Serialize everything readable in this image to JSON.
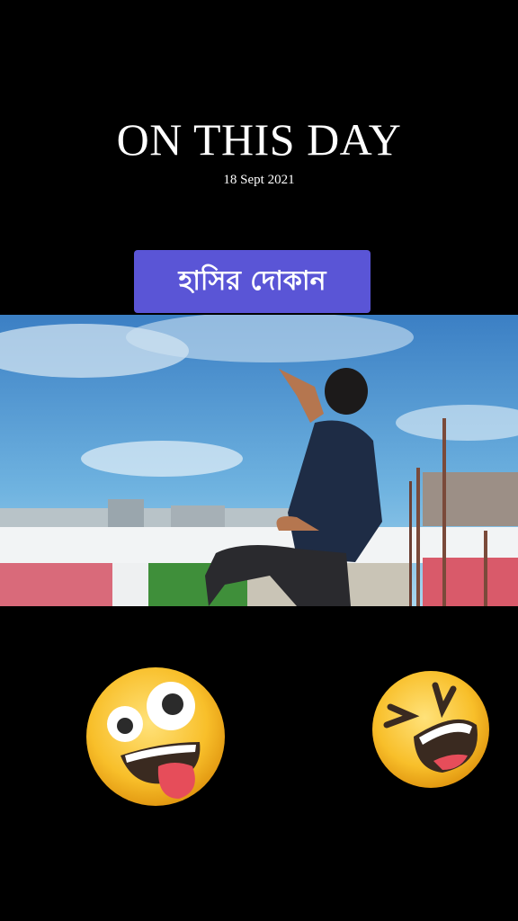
{
  "header": {
    "title": "ON THIS DAY",
    "date": "18 Sept 2021"
  },
  "label": {
    "text": "হাসির দোকান",
    "color": "#5a55d6"
  },
  "media": {
    "description_icon": "photo-dancing-man-rooftop"
  },
  "emojis": [
    {
      "name": "zany-face-icon"
    },
    {
      "name": "laughing-squint-face-icon"
    }
  ]
}
